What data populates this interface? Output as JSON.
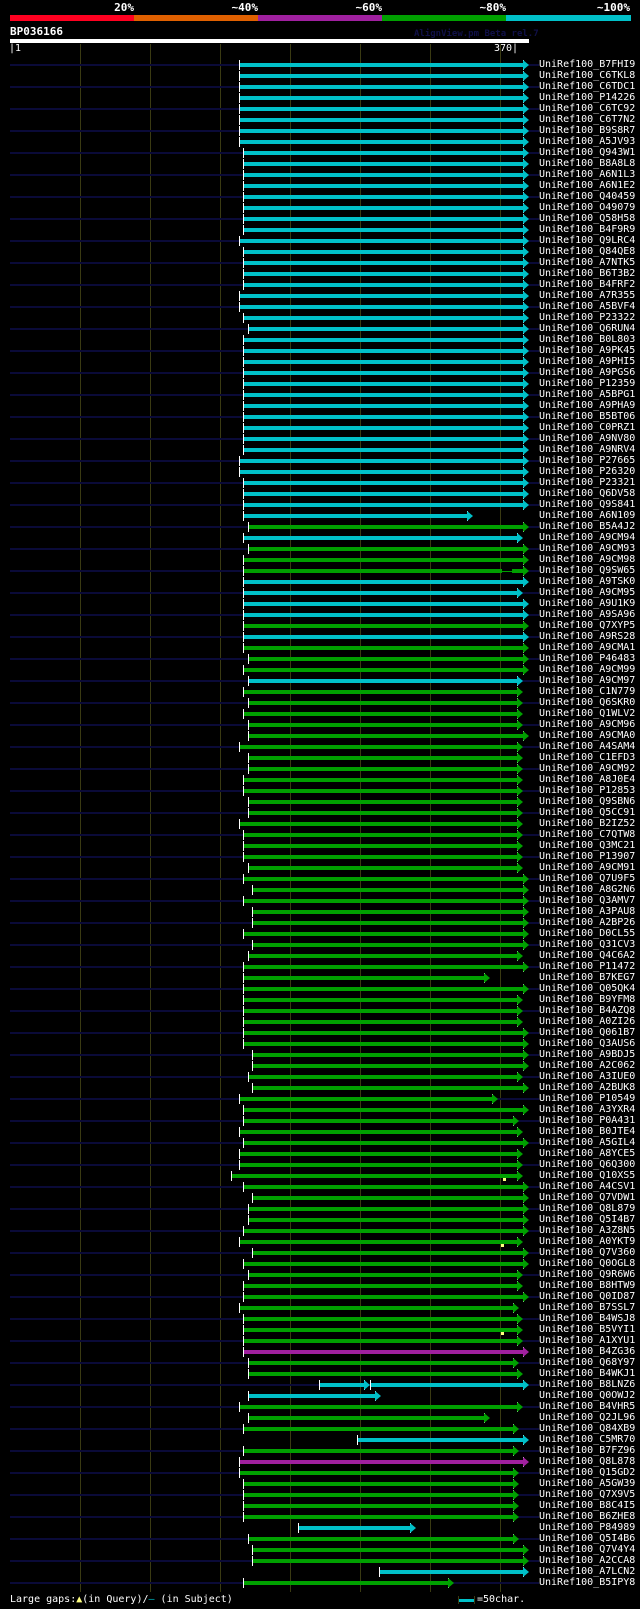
{
  "header": {
    "identity_scale": [
      {
        "label": "20%",
        "color": "#ff0020"
      },
      {
        "label": "~40%",
        "color": "#e06000"
      },
      {
        "label": "~60%",
        "color": "#a0209f"
      },
      {
        "label": "~80%",
        "color": "#00a000"
      },
      {
        "label": "~100%",
        "color": "#00c0c8"
      }
    ],
    "query_name": "BP036166",
    "version": "AlignView.pm Beta rel.7",
    "query_start": "|1",
    "query_end": "370|",
    "query_length": 370
  },
  "colors": {
    "cyan": "#00c0c8",
    "green": "#00a000",
    "magenta": "#a0209f",
    "guide": "#0a0a38",
    "gap": "#ffff80"
  },
  "rows": [
    {
      "label": "UniRef100_B7FHI9",
      "color": "cyan",
      "start": 164,
      "end": 370
    },
    {
      "label": "UniRef100_C6TKL8",
      "color": "cyan",
      "start": 164,
      "end": 370
    },
    {
      "label": "UniRef100_C6TDC1",
      "color": "cyan",
      "start": 164,
      "end": 370
    },
    {
      "label": "UniRef100_P14226",
      "color": "cyan",
      "start": 164,
      "end": 370
    },
    {
      "label": "UniRef100_C6TC92",
      "color": "cyan",
      "start": 164,
      "end": 370
    },
    {
      "label": "UniRef100_C6T7N2",
      "color": "cyan",
      "start": 164,
      "end": 370
    },
    {
      "label": "UniRef100_B9S8R7",
      "color": "cyan",
      "start": 164,
      "end": 370
    },
    {
      "label": "UniRef100_A5JV93",
      "color": "cyan",
      "start": 164,
      "end": 370
    },
    {
      "label": "UniRef100_Q943W1",
      "color": "cyan",
      "start": 167,
      "end": 370
    },
    {
      "label": "UniRef100_B8A8L8",
      "color": "cyan",
      "start": 167,
      "end": 370
    },
    {
      "label": "UniRef100_A6N1L3",
      "color": "cyan",
      "start": 167,
      "end": 370
    },
    {
      "label": "UniRef100_A6N1E2",
      "color": "cyan",
      "start": 167,
      "end": 370
    },
    {
      "label": "UniRef100_Q40459",
      "color": "cyan",
      "start": 167,
      "end": 370
    },
    {
      "label": "UniRef100_O49079",
      "color": "cyan",
      "start": 167,
      "end": 370
    },
    {
      "label": "UniRef100_Q58H58",
      "color": "cyan",
      "start": 167,
      "end": 370
    },
    {
      "label": "UniRef100_B4F9R9",
      "color": "cyan",
      "start": 167,
      "end": 370
    },
    {
      "label": "UniRef100_Q9LRC4",
      "color": "cyan",
      "start": 164,
      "end": 370
    },
    {
      "label": "UniRef100_Q84QE8",
      "color": "cyan",
      "start": 167,
      "end": 370
    },
    {
      "label": "UniRef100_A7NTK5",
      "color": "cyan",
      "start": 167,
      "end": 370
    },
    {
      "label": "UniRef100_B6T3B2",
      "color": "cyan",
      "start": 167,
      "end": 370
    },
    {
      "label": "UniRef100_B4FRF2",
      "color": "cyan",
      "start": 167,
      "end": 370
    },
    {
      "label": "UniRef100_A7R355",
      "color": "cyan",
      "start": 164,
      "end": 370
    },
    {
      "label": "UniRef100_A5BVF4",
      "color": "cyan",
      "start": 164,
      "end": 370
    },
    {
      "label": "UniRef100_P23322",
      "color": "cyan",
      "start": 167,
      "end": 370
    },
    {
      "label": "UniRef100_Q6RUN4",
      "color": "cyan",
      "start": 170,
      "end": 370
    },
    {
      "label": "UniRef100_B0L803",
      "color": "cyan",
      "start": 167,
      "end": 370
    },
    {
      "label": "UniRef100_A9PK45",
      "color": "cyan",
      "start": 167,
      "end": 370
    },
    {
      "label": "UniRef100_A9PHI5",
      "color": "cyan",
      "start": 167,
      "end": 370
    },
    {
      "label": "UniRef100_A9PGS6",
      "color": "cyan",
      "start": 167,
      "end": 370
    },
    {
      "label": "UniRef100_P12359",
      "color": "cyan",
      "start": 167,
      "end": 370
    },
    {
      "label": "UniRef100_A5BPG1",
      "color": "cyan",
      "start": 167,
      "end": 370
    },
    {
      "label": "UniRef100_A9PHA9",
      "color": "cyan",
      "start": 167,
      "end": 370
    },
    {
      "label": "UniRef100_B5BT06",
      "color": "cyan",
      "start": 167,
      "end": 370
    },
    {
      "label": "UniRef100_C0PRZ1",
      "color": "cyan",
      "start": 167,
      "end": 370
    },
    {
      "label": "UniRef100_A9NV80",
      "color": "cyan",
      "start": 167,
      "end": 370
    },
    {
      "label": "UniRef100_A9NRV4",
      "color": "cyan",
      "start": 167,
      "end": 370
    },
    {
      "label": "UniRef100_P27665",
      "color": "cyan",
      "start": 164,
      "end": 370
    },
    {
      "label": "UniRef100_P26320",
      "color": "cyan",
      "start": 164,
      "end": 370
    },
    {
      "label": "UniRef100_P23321",
      "color": "cyan",
      "start": 167,
      "end": 370
    },
    {
      "label": "UniRef100_Q6DV58",
      "color": "cyan",
      "start": 167,
      "end": 370
    },
    {
      "label": "UniRef100_Q9S841",
      "color": "cyan",
      "start": 167,
      "end": 370
    },
    {
      "label": "UniRef100_A6N109",
      "color": "cyan",
      "start": 167,
      "end": 330
    },
    {
      "label": "UniRef100_B5A4J2",
      "color": "green",
      "start": 170,
      "end": 370
    },
    {
      "label": "UniRef100_A9CM94",
      "color": "cyan",
      "start": 167,
      "end": 366
    },
    {
      "label": "UniRef100_A9CM93",
      "color": "green",
      "start": 170,
      "end": 370
    },
    {
      "label": "UniRef100_A9CM98",
      "color": "green",
      "start": 167,
      "end": 370
    },
    {
      "label": "UniRef100_Q9SW65",
      "color": "green",
      "start": 167,
      "end": 370,
      "subject_gap": [
        351,
        358
      ]
    },
    {
      "label": "UniRef100_A9TSK0",
      "color": "cyan",
      "start": 167,
      "end": 370
    },
    {
      "label": "UniRef100_A9CM95",
      "color": "cyan",
      "start": 167,
      "end": 366
    },
    {
      "label": "UniRef100_A9U1K9",
      "color": "cyan",
      "start": 167,
      "end": 370
    },
    {
      "label": "UniRef100_A9SA96",
      "color": "cyan",
      "start": 167,
      "end": 370
    },
    {
      "label": "UniRef100_Q7XYP5",
      "color": "green",
      "start": 167,
      "end": 370
    },
    {
      "label": "UniRef100_A9RS28",
      "color": "cyan",
      "start": 167,
      "end": 370
    },
    {
      "label": "UniRef100_A9CMA1",
      "color": "green",
      "start": 167,
      "end": 370
    },
    {
      "label": "UniRef100_P46483",
      "color": "green",
      "start": 170,
      "end": 370
    },
    {
      "label": "UniRef100_A9CM99",
      "color": "green",
      "start": 167,
      "end": 370
    },
    {
      "label": "UniRef100_A9CM97",
      "color": "cyan",
      "start": 170,
      "end": 366
    },
    {
      "label": "UniRef100_C1N779",
      "color": "green",
      "start": 167,
      "end": 366
    },
    {
      "label": "UniRef100_Q6SKR0",
      "color": "green",
      "start": 170,
      "end": 366
    },
    {
      "label": "UniRef100_Q1WLV2",
      "color": "green",
      "start": 167,
      "end": 366
    },
    {
      "label": "UniRef100_A9CM96",
      "color": "green",
      "start": 170,
      "end": 366
    },
    {
      "label": "UniRef100_A9CMA0",
      "color": "green",
      "start": 170,
      "end": 370
    },
    {
      "label": "UniRef100_A4SAM4",
      "color": "green",
      "start": 164,
      "end": 366
    },
    {
      "label": "UniRef100_C1EFD3",
      "color": "green",
      "start": 170,
      "end": 366
    },
    {
      "label": "UniRef100_A9CM92",
      "color": "green",
      "start": 170,
      "end": 366
    },
    {
      "label": "UniRef100_A8J0E4",
      "color": "green",
      "start": 167,
      "end": 366
    },
    {
      "label": "UniRef100_P12853",
      "color": "green",
      "start": 167,
      "end": 366
    },
    {
      "label": "UniRef100_Q9SBN6",
      "color": "green",
      "start": 170,
      "end": 366
    },
    {
      "label": "UniRef100_Q5CC91",
      "color": "green",
      "start": 170,
      "end": 366
    },
    {
      "label": "UniRef100_B2IZ52",
      "color": "green",
      "start": 164,
      "end": 366
    },
    {
      "label": "UniRef100_C7QTW8",
      "color": "green",
      "start": 167,
      "end": 366
    },
    {
      "label": "UniRef100_Q3MC21",
      "color": "green",
      "start": 167,
      "end": 366
    },
    {
      "label": "UniRef100_P13907",
      "color": "green",
      "start": 167,
      "end": 366
    },
    {
      "label": "UniRef100_A9CM91",
      "color": "green",
      "start": 170,
      "end": 366
    },
    {
      "label": "UniRef100_Q7U9F5",
      "color": "green",
      "start": 167,
      "end": 370
    },
    {
      "label": "UniRef100_A8G2N6",
      "color": "green",
      "start": 173,
      "end": 370
    },
    {
      "label": "UniRef100_Q3AMV7",
      "color": "green",
      "start": 167,
      "end": 370
    },
    {
      "label": "UniRef100_A3PAU8",
      "color": "green",
      "start": 173,
      "end": 370
    },
    {
      "label": "UniRef100_A2BP26",
      "color": "green",
      "start": 173,
      "end": 370
    },
    {
      "label": "UniRef100_D0CL55",
      "color": "green",
      "start": 167,
      "end": 370
    },
    {
      "label": "UniRef100_Q31CV3",
      "color": "green",
      "start": 173,
      "end": 370
    },
    {
      "label": "UniRef100_Q4C6A2",
      "color": "green",
      "start": 170,
      "end": 366
    },
    {
      "label": "UniRef100_P11472",
      "color": "green",
      "start": 167,
      "end": 370
    },
    {
      "label": "UniRef100_B7KEG7",
      "color": "green",
      "start": 167,
      "end": 342
    },
    {
      "label": "UniRef100_Q05QK4",
      "color": "green",
      "start": 167,
      "end": 370
    },
    {
      "label": "UniRef100_B9YFM8",
      "color": "green",
      "start": 167,
      "end": 366
    },
    {
      "label": "UniRef100_B4AZQ8",
      "color": "green",
      "start": 167,
      "end": 366
    },
    {
      "label": "UniRef100_A0ZI26",
      "color": "green",
      "start": 167,
      "end": 366
    },
    {
      "label": "UniRef100_Q061B7",
      "color": "green",
      "start": 167,
      "end": 370
    },
    {
      "label": "UniRef100_Q3AUS6",
      "color": "green",
      "start": 167,
      "end": 370
    },
    {
      "label": "UniRef100_A9BDJ5",
      "color": "green",
      "start": 173,
      "end": 370
    },
    {
      "label": "UniRef100_A2C062",
      "color": "green",
      "start": 173,
      "end": 370
    },
    {
      "label": "UniRef100_A3IUE0",
      "color": "green",
      "start": 170,
      "end": 366
    },
    {
      "label": "UniRef100_A2BUK8",
      "color": "green",
      "start": 173,
      "end": 370
    },
    {
      "label": "UniRef100_P10549",
      "color": "green",
      "start": 164,
      "end": 348
    },
    {
      "label": "UniRef100_A3YXR4",
      "color": "green",
      "start": 167,
      "end": 370
    },
    {
      "label": "UniRef100_P0A431",
      "color": "green",
      "start": 167,
      "end": 363
    },
    {
      "label": "UniRef100_B0JTE4",
      "color": "green",
      "start": 164,
      "end": 366
    },
    {
      "label": "UniRef100_A5GIL4",
      "color": "green",
      "start": 167,
      "end": 370
    },
    {
      "label": "UniRef100_A8YCE5",
      "color": "green",
      "start": 164,
      "end": 366
    },
    {
      "label": "UniRef100_Q6Q300",
      "color": "green",
      "start": 164,
      "end": 366
    },
    {
      "label": "UniRef100_Q10XS5",
      "color": "green",
      "start": 158,
      "end": 366,
      "query_gap": 352
    },
    {
      "label": "UniRef100_A4CSV1",
      "color": "green",
      "start": 167,
      "end": 370
    },
    {
      "label": "UniRef100_Q7VDW1",
      "color": "green",
      "start": 173,
      "end": 370
    },
    {
      "label": "UniRef100_Q8L879",
      "color": "green",
      "start": 170,
      "end": 370
    },
    {
      "label": "UniRef100_Q5I4B7",
      "color": "green",
      "start": 170,
      "end": 370
    },
    {
      "label": "UniRef100_A3Z8N5",
      "color": "green",
      "start": 167,
      "end": 370
    },
    {
      "label": "UniRef100_A0YKT9",
      "color": "green",
      "start": 164,
      "end": 366,
      "query_gap": 351
    },
    {
      "label": "UniRef100_Q7V360",
      "color": "green",
      "start": 173,
      "end": 370
    },
    {
      "label": "UniRef100_Q0OGL8",
      "color": "green",
      "start": 167,
      "end": 370
    },
    {
      "label": "UniRef100_Q9R6W6",
      "color": "green",
      "start": 170,
      "end": 366
    },
    {
      "label": "UniRef100_B8HTW9",
      "color": "green",
      "start": 167,
      "end": 366
    },
    {
      "label": "UniRef100_Q0ID87",
      "color": "green",
      "start": 167,
      "end": 370
    },
    {
      "label": "UniRef100_B7SSL7",
      "color": "green",
      "start": 164,
      "end": 363
    },
    {
      "label": "UniRef100_B4WSJ8",
      "color": "green",
      "start": 167,
      "end": 366
    },
    {
      "label": "UniRef100_B5VYI1",
      "color": "green",
      "start": 167,
      "end": 366,
      "query_gap": 351
    },
    {
      "label": "UniRef100_A1XYU1",
      "color": "green",
      "start": 167,
      "end": 366
    },
    {
      "label": "UniRef100_B4ZG36",
      "color": "magenta",
      "start": 167,
      "end": 370
    },
    {
      "label": "UniRef100_Q68Y97",
      "color": "green",
      "start": 170,
      "end": 363
    },
    {
      "label": "UniRef100_B4WKJ1",
      "color": "green",
      "start": 170,
      "end": 366
    },
    {
      "label": "UniRef100_B8LNZ6",
      "color": "cyan",
      "start": 221,
      "end": 257,
      "start2": 257,
      "end2": 370
    },
    {
      "label": "UniRef100_Q0OWJ2",
      "color": "cyan",
      "start": 170,
      "end": 265
    },
    {
      "label": "UniRef100_B4VHR5",
      "color": "green",
      "start": 164,
      "end": 366
    },
    {
      "label": "UniRef100_Q2JL96",
      "color": "green",
      "start": 170,
      "end": 342
    },
    {
      "label": "UniRef100_Q84XB9",
      "color": "green",
      "start": 167,
      "end": 363
    },
    {
      "label": "UniRef100_C5MR70",
      "color": "cyan",
      "start": 248,
      "end": 370
    },
    {
      "label": "UniRef100_B7FZ96",
      "color": "green",
      "start": 167,
      "end": 363
    },
    {
      "label": "UniRef100_Q8L878",
      "color": "magenta",
      "start": 164,
      "end": 370
    },
    {
      "label": "UniRef100_Q15GD2",
      "color": "green",
      "start": 164,
      "end": 363
    },
    {
      "label": "UniRef100_A5GW39",
      "color": "green",
      "start": 167,
      "end": 363
    },
    {
      "label": "UniRef100_Q7X9V5",
      "color": "green",
      "start": 167,
      "end": 363
    },
    {
      "label": "UniRef100_B8C4I5",
      "color": "green",
      "start": 167,
      "end": 363
    },
    {
      "label": "UniRef100_B6ZHE8",
      "color": "green",
      "start": 167,
      "end": 363
    },
    {
      "label": "UniRef100_P84989",
      "color": "cyan",
      "start": 206,
      "end": 290
    },
    {
      "label": "UniRef100_Q5I4B6",
      "color": "green",
      "start": 170,
      "end": 363
    },
    {
      "label": "UniRef100_Q7V4Y4",
      "color": "green",
      "start": 173,
      "end": 370
    },
    {
      "label": "UniRef100_A2CCA8",
      "color": "green",
      "start": 173,
      "end": 370
    },
    {
      "label": "UniRef100_A7LCN2",
      "color": "cyan",
      "start": 263,
      "end": 370
    },
    {
      "label": "UniRef100_B5IPY8",
      "color": "green",
      "start": 167,
      "end": 317
    }
  ],
  "footer": {
    "large_gaps_label": "Large gaps:",
    "query_gap_symbol": "▲",
    "query_gap_label": "(in Query)/",
    "subject_gap_symbol": "—",
    "subject_gap_label": " (in Subject)",
    "scale_label": "=50char."
  }
}
